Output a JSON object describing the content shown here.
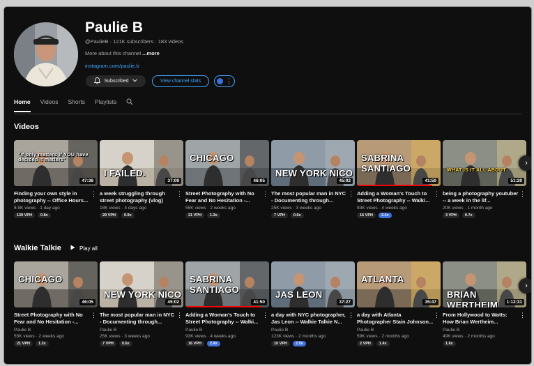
{
  "channel": {
    "name": "Paulie B",
    "meta": "@PaulieB · 121K subscribers · 183 videos",
    "about_prefix": "More about this channel",
    "about_more": " ...more",
    "link": "instagram.com/paulie.b",
    "subscribed_label": "Subscribed",
    "stats_label": "View channel stats"
  },
  "tabs": [
    {
      "label": "Home"
    },
    {
      "label": "Videos"
    },
    {
      "label": "Shorts"
    },
    {
      "label": "Playlists"
    }
  ],
  "sections": {
    "videos_title": "Videos",
    "walkie_title": "Walkie Talkie",
    "play_all": "Play all"
  },
  "videos_row": [
    {
      "title": "Finding your own style in photography -- Office Hours...",
      "meta": "8.9K views · 1 day ago",
      "vph": "139 VPH",
      "ratio": "0.8x",
      "ratio_blue": false,
      "duration": "47:38",
      "overlay": "\"If only matters if YOU have decided it matters\"",
      "progress": 0
    },
    {
      "title": "a week struggling through street photography (vlog)",
      "meta": "18K views · 4 days ago",
      "vph": "29 VPH",
      "ratio": "0.9x",
      "ratio_blue": false,
      "duration": "37:09",
      "overlay": "I FAILED.",
      "progress": 0
    },
    {
      "title": "Street Photography with No Fear and No Hesitation -...",
      "meta": "55K views · 2 weeks ago",
      "vph": "21 VPH",
      "ratio": "1.3x",
      "ratio_blue": false,
      "duration": "46:05",
      "overlay": "CHICAGO",
      "progress": 0
    },
    {
      "title": "The most popular man in NYC - Documenting through...",
      "meta": "25K views · 3 weeks ago",
      "vph": "7 VPH",
      "ratio": "0.6x",
      "ratio_blue": false,
      "duration": "45:02",
      "overlay": "NEW YORK NICO",
      "progress": 0
    },
    {
      "title": "Adding a Woman's Touch to Street Photography -- Walki...",
      "meta": "93K views · 4 weeks ago",
      "vph": "16 VPH",
      "ratio": "2.4x",
      "ratio_blue": true,
      "duration": "41:50",
      "overlay": "SABRINA SANTIAGO",
      "progress": 0.9
    },
    {
      "title": "being a photography youtuber -- a week in the lif...",
      "meta": "20K views · 1 month ago",
      "vph": "3 VPH",
      "ratio": "0.7x",
      "ratio_blue": false,
      "duration": "51:20",
      "overlay": "WHAT IS IT ALL ABOUT",
      "progress": 0
    }
  ],
  "walkie_row": [
    {
      "title": "Street Photography with No Fear and No Hesitation -...",
      "author": "Paulie B",
      "meta": "55K views · 2 weeks ago",
      "vph": "21 VPH",
      "ratio": "1.3x",
      "ratio_blue": false,
      "duration": "46:05",
      "overlay": "CHICAGO",
      "progress": 0
    },
    {
      "title": "The most popular man in NYC - Documenting through...",
      "author": "Paulie B",
      "meta": "25K views · 3 weeks ago",
      "vph": "7 VPH",
      "ratio": "0.6x",
      "ratio_blue": false,
      "duration": "45:02",
      "overlay": "NEW YORK NICO",
      "progress": 0
    },
    {
      "title": "Adding a Woman's Touch to Street Photography -- Walki...",
      "author": "Paulie B",
      "meta": "93K views · 4 weeks ago",
      "vph": "16 VPH",
      "ratio": "2.4x",
      "ratio_blue": true,
      "duration": "41:50",
      "overlay": "SABRINA SANTIAGO",
      "progress": 0.9
    },
    {
      "title": "a day with NYC photographer, Jas Leon -- Walkie Talkie N...",
      "author": "Paulie B",
      "meta": "123K views · 2 months ago",
      "vph": "10 VPH",
      "ratio": "2.9x",
      "ratio_blue": true,
      "duration": "37:27",
      "overlay": "JAS LEON",
      "progress": 0
    },
    {
      "title": "a day with Atlanta Photographer Stain Johnson...",
      "author": "Paulie B",
      "meta": "59K views · 2 months ago",
      "vph": "2 VPH",
      "ratio": "1.4x",
      "ratio_blue": false,
      "duration": "35:47",
      "overlay": "ATLANTA",
      "progress": 0
    },
    {
      "title": "From Hollywood to Watts: How Brian Wertheim...",
      "author": "Paulie B",
      "meta": "49K views · 2 months ago",
      "vph": "",
      "ratio": "1.6x",
      "ratio_blue": false,
      "duration": "1:12:31",
      "overlay": "BRIAN WERTHEIM",
      "progress": 0
    }
  ],
  "colors": {
    "background": "#0f0f0f",
    "accent_blue": "#3ea6ff",
    "badge_blue": "#3f6fd8",
    "progress_red": "#ff0000"
  },
  "icons": [
    "bell-icon",
    "chevron-down-icon",
    "search-icon",
    "play-icon",
    "chevron-right-icon",
    "more-vert-icon",
    "extension-icon"
  ]
}
